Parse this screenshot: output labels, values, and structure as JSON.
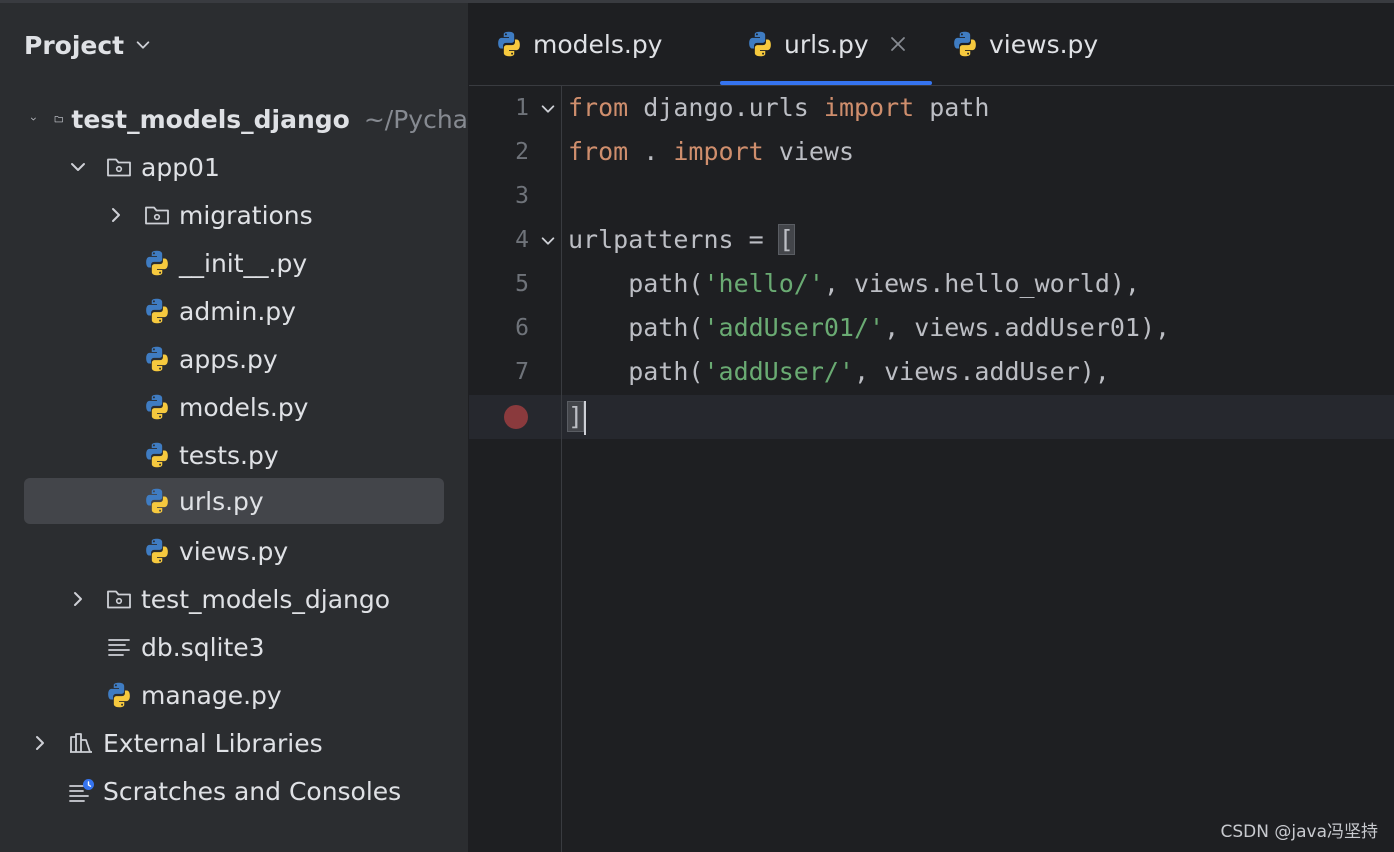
{
  "panel": {
    "title": "Project"
  },
  "tree": {
    "root": {
      "name": "test_models_django",
      "path": "~/Pycha"
    },
    "app01": "app01",
    "migrations": "migrations",
    "init_py": "__init__.py",
    "admin_py": "admin.py",
    "apps_py": "apps.py",
    "models_py": "models.py",
    "tests_py": "tests.py",
    "urls_py": "urls.py",
    "views_py": "views.py",
    "pkg": "test_models_django",
    "db": "db.sqlite3",
    "manage_py": "manage.py",
    "ext_libs": "External Libraries",
    "scratches": "Scratches and Consoles"
  },
  "tabs": [
    {
      "label": "models.py"
    },
    {
      "label": "urls.py",
      "active": true
    },
    {
      "label": "views.py"
    }
  ],
  "code": {
    "line_numbers": [
      "1",
      "2",
      "3",
      "4",
      "5",
      "6",
      "7",
      ""
    ],
    "l1": {
      "kw1": "from",
      "t1": " django.urls ",
      "kw2": "import",
      "t2": " path"
    },
    "l2": {
      "kw1": "from",
      "t1": " . ",
      "kw2": "import",
      "t2": " views"
    },
    "l4": {
      "t1": "urlpatterns = ",
      "brk": "["
    },
    "l5": {
      "t1": "    path(",
      "s": "'hello/'",
      "t2": ", views.hello_world),"
    },
    "l6": {
      "t1": "    path(",
      "s": "'addUser01/'",
      "t2": ", views.addUser01),"
    },
    "l7": {
      "t1": "    path(",
      "s": "'addUser/'",
      "t2": ", views.addUser),"
    },
    "l8": {
      "brk": "]"
    }
  },
  "watermark": "CSDN @java冯坚持",
  "colors": {
    "keyword": "#cf8e6d",
    "string": "#6aab73",
    "accent": "#3574f0",
    "breakpoint": "#8a3a3d"
  }
}
